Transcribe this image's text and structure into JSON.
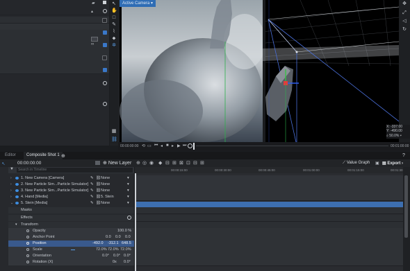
{
  "viewport": {
    "camera_label": "Active Camera",
    "coords": {
      "x": "X: -337.00",
      "y": "Y: -490.00"
    },
    "zoom": "50.0%",
    "timecode_start": "00:00:00:00",
    "timecode_end": "00:01:00:00"
  },
  "tabs": {
    "editor": "Editor",
    "composite": "Composite Shot 1"
  },
  "timeline": {
    "timecode": "00:00:00:00",
    "new_layer": "New Layer",
    "value_graph": "Value Graph",
    "export": "Export",
    "search_placeholder": "Search in Timeline",
    "ruler": [
      "00:00:15:00",
      "00:00:30:00",
      "00:00:45:00",
      "00:01:00:00",
      "00:01:15:00",
      "00:01:30:00"
    ],
    "layers": [
      {
        "name": "1. New Camera [Camera]",
        "parent": "None"
      },
      {
        "name": "2. New Particle Sim...Particle Simulator]",
        "parent": "None"
      },
      {
        "name": "3. New Particle Sim...Particle Simulator]",
        "parent": "None"
      },
      {
        "name": "4. Hand [Media]",
        "parent": "5. Stein"
      },
      {
        "name": "5. Stein [Media]",
        "parent": "None"
      }
    ],
    "groups": {
      "masks": "Masks",
      "effects": "Effects",
      "transform": "Transform"
    },
    "props": [
      {
        "name": "Opacity",
        "v1": "100.0 %",
        "v2": "",
        "v3": ""
      },
      {
        "name": "Anchor Point",
        "v1": "0.0",
        "v2": "0.0",
        "v3": "0.0"
      },
      {
        "name": "Position",
        "v1": "-492.0",
        "v2": "-312.1",
        "v3": "648.5"
      },
      {
        "name": "Scale",
        "v1": "72.0%",
        "v2": "72.0%",
        "v3": "72.0%"
      },
      {
        "name": "Orientation",
        "v1": "0.0°",
        "v2": "0.0°",
        "v3": "0.0°"
      },
      {
        "name": "Rotation (X)",
        "v1": "0x",
        "v2": "0.0°",
        "v3": ""
      }
    ]
  },
  "colors": {
    "accent": "#3a78c9",
    "selected": "#39598c",
    "track": "#3d6fb0"
  }
}
